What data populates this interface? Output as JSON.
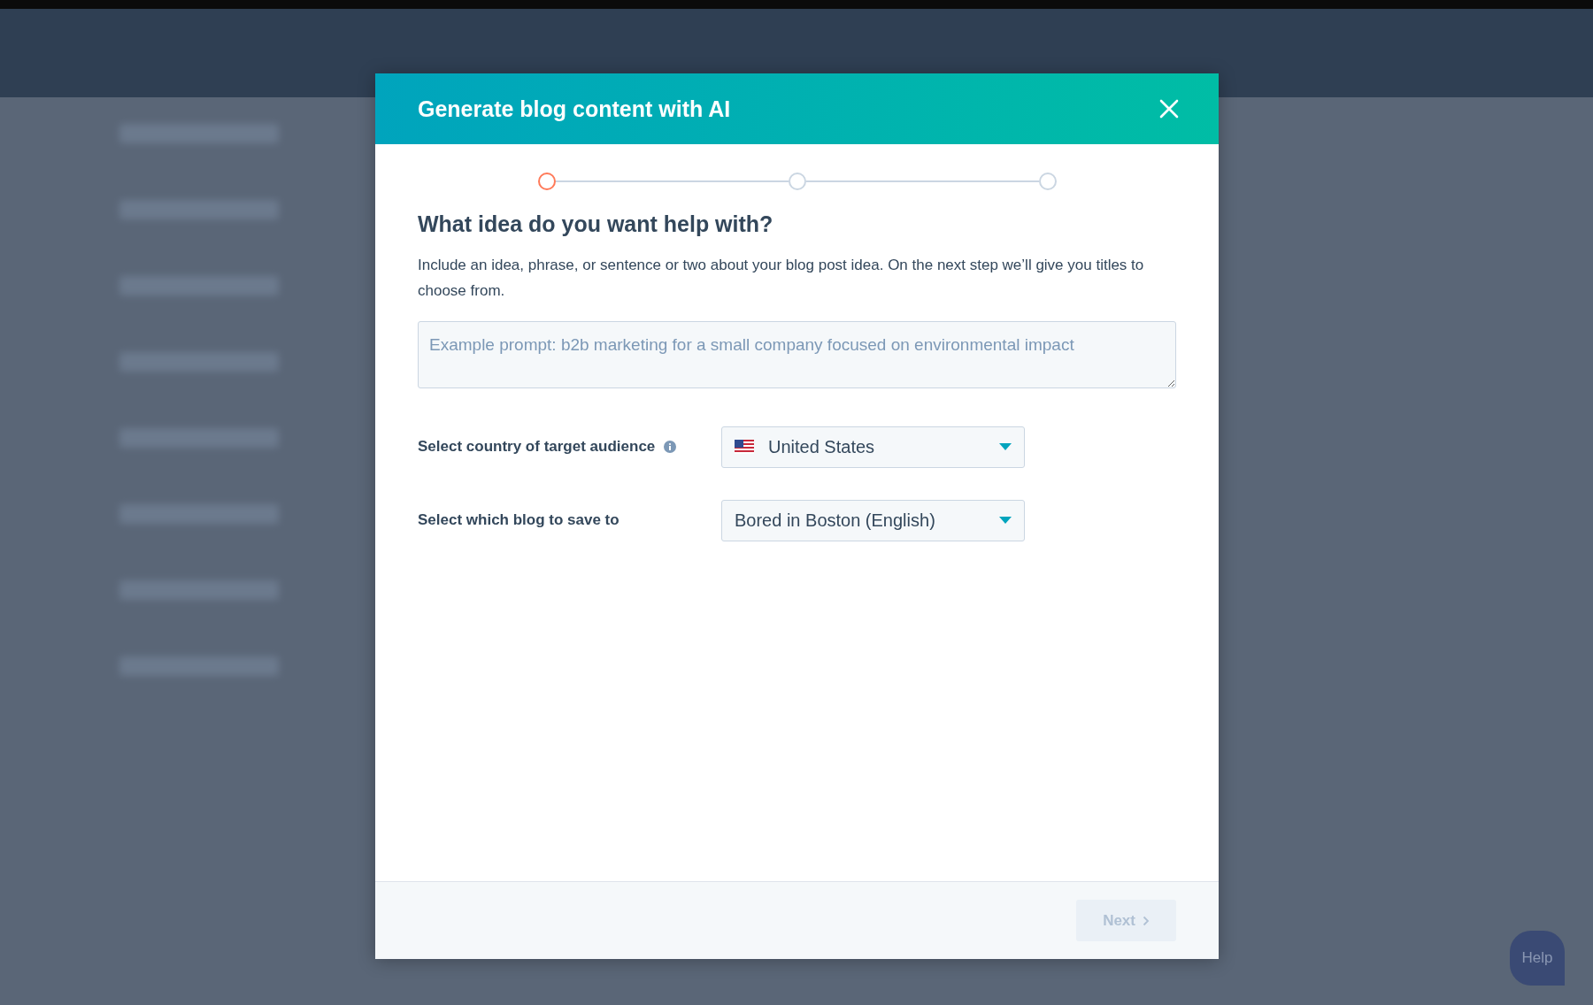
{
  "dialog": {
    "title": "Generate blog content with AI",
    "steps": [
      {
        "selected": true
      },
      {
        "selected": false
      },
      {
        "selected": false
      }
    ],
    "heading": "What idea do you want help with?",
    "description": "Include an idea, phrase, or sentence or two about your blog post idea. On the next step we’ll give you titles to choose from.",
    "prompt": {
      "placeholder": "Example prompt: b2b marketing for a small company focused on environmental impact"
    },
    "fields": [
      {
        "kind": "country",
        "label": "Select country of target audience",
        "info": true,
        "value": "United States"
      },
      {
        "kind": "plain",
        "label": "Select which blog to save to",
        "info": false,
        "value": "Bored in Boston (English)"
      }
    ],
    "next_button": {
      "label": "Next",
      "disabled": true
    }
  },
  "help_button": {
    "label": "Help"
  }
}
